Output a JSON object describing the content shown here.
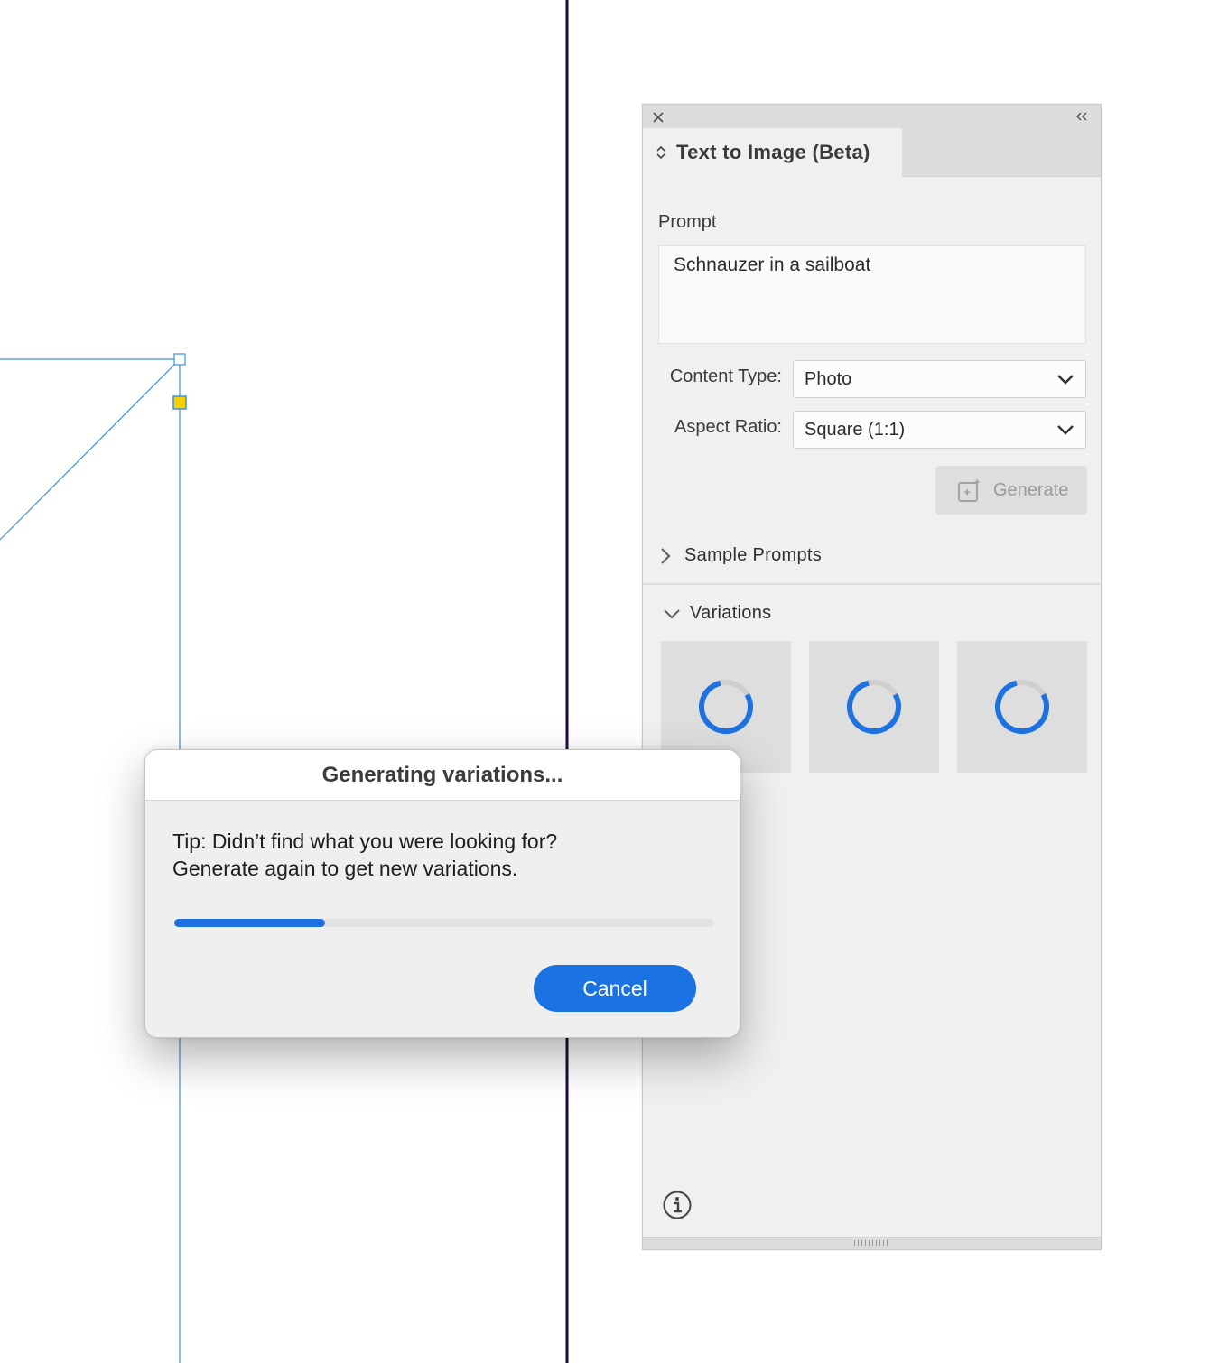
{
  "panel": {
    "tab_title": "Text to Image (Beta)",
    "prompt_label": "Prompt",
    "prompt_value": "Schnauzer in a sailboat",
    "content_type_label": "Content Type:",
    "content_type_value": "Photo",
    "aspect_ratio_label": "Aspect Ratio:",
    "aspect_ratio_value": "Square (1:1)",
    "generate_label": "Generate",
    "sample_prompts_label": "Sample Prompts",
    "variations_label": "Variations",
    "variation_count": 3,
    "icons": [
      "close-icon",
      "collapse-icon",
      "updown-icon",
      "chevron-down-icon",
      "chevron-right-icon",
      "generate-image-icon",
      "spinner-icon",
      "info-icon"
    ]
  },
  "dialog": {
    "title": "Generating variations...",
    "tip_line1": "Tip: Didn’t find what you were looking for?",
    "tip_line2": "Generate again to get new variations.",
    "progress_fraction": 0.28,
    "cancel_label": "Cancel"
  },
  "colors": {
    "accent": "#1b72e3",
    "guide": "#3a93d8",
    "margin_line": "#1e0b3b",
    "anchor_fill": "#f5d000"
  }
}
